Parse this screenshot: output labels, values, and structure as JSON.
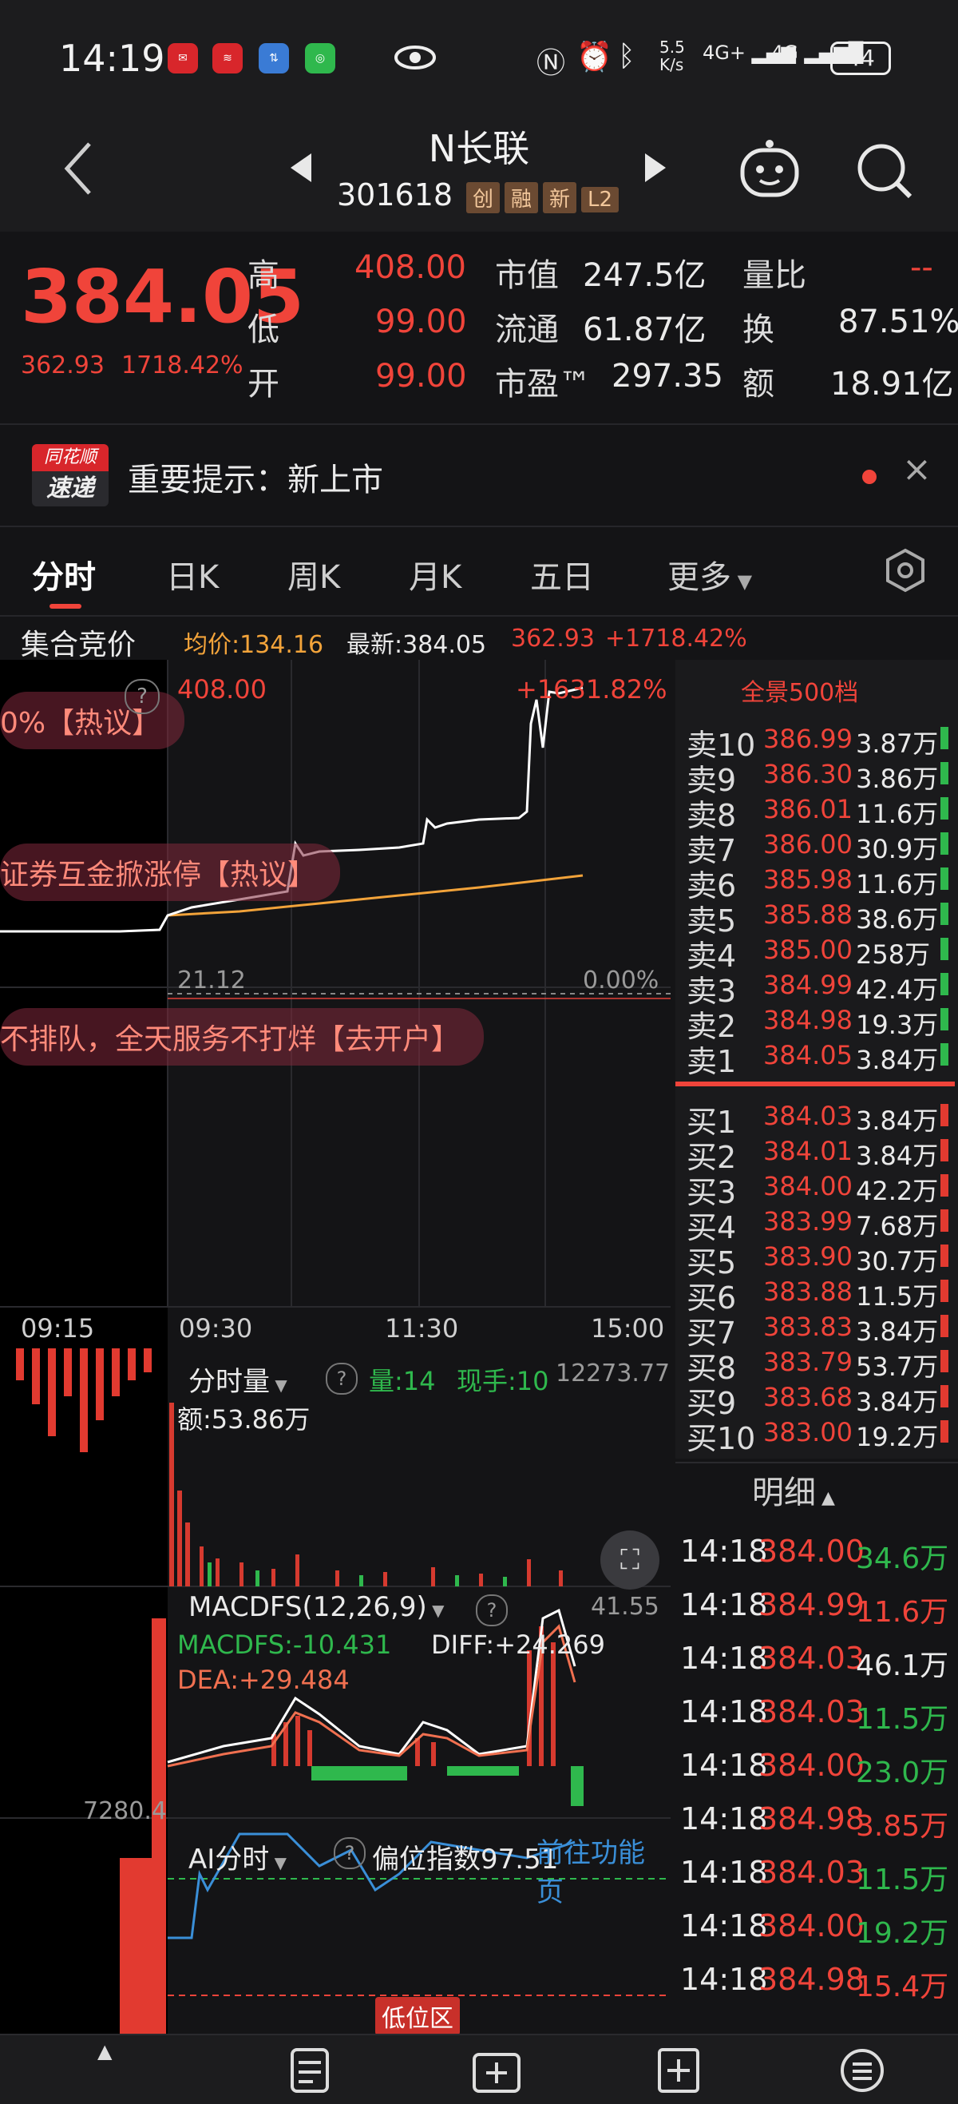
{
  "status_bar": {
    "time": "14:19",
    "net_speed_top": "5.5",
    "net_speed_bottom": "K/s",
    "signal1": "4G+",
    "signal2": "4G",
    "battery": "44"
  },
  "header": {
    "title": "N长联",
    "code": "301618",
    "tags": [
      "创",
      "融",
      "新",
      "L2"
    ]
  },
  "quote": {
    "price": "384.05",
    "change": "362.93",
    "change_pct": "1718.42%",
    "high_label": "高",
    "high": "408.00",
    "low_label": "低",
    "low": "99.00",
    "open_label": "开",
    "open": "99.00",
    "mcap_label": "市值",
    "mcap": "247.5亿",
    "float_label": "流通",
    "float": "61.87亿",
    "pe_label": "市盈™",
    "pe": "297.35",
    "vol_ratio_label": "量比",
    "vol_ratio": "--",
    "turnover_label": "换",
    "turnover": "87.51%",
    "amount_label": "额",
    "amount": "18.91亿"
  },
  "notice": {
    "logo_top": "同花顺",
    "logo_bottom": "速递",
    "text": "重要提示：新上市"
  },
  "tabs": [
    "分时",
    "日K",
    "周K",
    "月K",
    "五日",
    "更多"
  ],
  "info_line": {
    "label": "集合竞价",
    "avg": "均价:134.16",
    "latest": "最新:384.05",
    "chg": "362.93",
    "pct": "+1718.42%"
  },
  "chart": {
    "top_price": "408.00",
    "top_pct": "+1631.82%",
    "base_price": "21.12",
    "base_pct": "0.00%",
    "banner1": "0%【热议】",
    "banner2": "证券互金掀涨停【热议】",
    "banner3": "不排队，全天服务不打烊【去开户】",
    "times": [
      "09:15",
      "09:30",
      "11:30",
      "15:00"
    ],
    "vol_title": "分时量",
    "vol_qty": "量:14",
    "vol_hand": "现手:10",
    "vol_max": "12273.77",
    "vol_amount": "额:53.86万",
    "vol_side": "7280.4",
    "macd_title": "MACDFS(12,26,9)",
    "macd_val": "MACDFS:-10.431",
    "diff_val": "DIFF:+24.269",
    "dea_val": "DEA:+29.484",
    "macd_max": "41.55",
    "ai_title": "AI分时",
    "ai_index": "偏位指数97.51",
    "ai_func": "前往功能页",
    "ai_low": "低位区"
  },
  "orderbook": {
    "title": "全景500档",
    "sells": [
      {
        "k": "卖10",
        "p": "386.99",
        "v": "3.87万"
      },
      {
        "k": "卖9",
        "p": "386.30",
        "v": "3.86万"
      },
      {
        "k": "卖8",
        "p": "386.01",
        "v": "11.6万"
      },
      {
        "k": "卖7",
        "p": "386.00",
        "v": "30.9万"
      },
      {
        "k": "卖6",
        "p": "385.98",
        "v": "11.6万"
      },
      {
        "k": "卖5",
        "p": "385.88",
        "v": "38.6万"
      },
      {
        "k": "卖4",
        "p": "385.00",
        "v": "258万"
      },
      {
        "k": "卖3",
        "p": "384.99",
        "v": "42.4万"
      },
      {
        "k": "卖2",
        "p": "384.98",
        "v": "19.3万"
      },
      {
        "k": "卖1",
        "p": "384.05",
        "v": "3.84万"
      }
    ],
    "buys": [
      {
        "k": "买1",
        "p": "384.03",
        "v": "3.84万"
      },
      {
        "k": "买2",
        "p": "384.01",
        "v": "3.84万"
      },
      {
        "k": "买3",
        "p": "384.00",
        "v": "42.2万"
      },
      {
        "k": "买4",
        "p": "383.99",
        "v": "7.68万"
      },
      {
        "k": "买5",
        "p": "383.90",
        "v": "30.7万"
      },
      {
        "k": "买6",
        "p": "383.88",
        "v": "11.5万"
      },
      {
        "k": "买7",
        "p": "383.83",
        "v": "3.84万"
      },
      {
        "k": "买8",
        "p": "383.79",
        "v": "53.7万"
      },
      {
        "k": "买9",
        "p": "383.68",
        "v": "3.84万"
      },
      {
        "k": "买10",
        "p": "383.00",
        "v": "19.2万"
      }
    ]
  },
  "ticks": {
    "title": "明细",
    "rows": [
      {
        "t": "14:18",
        "p": "384.00",
        "v": "34.6万",
        "dir": "green"
      },
      {
        "t": "14:18",
        "p": "384.99",
        "v": "11.6万",
        "dir": "red"
      },
      {
        "t": "14:18",
        "p": "384.03",
        "v": "46.1万",
        "dir": "white"
      },
      {
        "t": "14:18",
        "p": "384.03",
        "v": "11.5万",
        "dir": "green"
      },
      {
        "t": "14:18",
        "p": "384.00",
        "v": "23.0万",
        "dir": "green"
      },
      {
        "t": "14:18",
        "p": "384.98",
        "v": "3.85万",
        "dir": "red"
      },
      {
        "t": "14:18",
        "p": "384.03",
        "v": "11.5万",
        "dir": "green"
      },
      {
        "t": "14:18",
        "p": "384.00",
        "v": "19.2万",
        "dir": "green"
      },
      {
        "t": "14:18",
        "p": "384.98",
        "v": "15.4万",
        "dir": "red"
      }
    ]
  },
  "colors": {
    "up": "#f0443a",
    "down": "#2fb84d",
    "avg": "#f2a33a",
    "line": "#ffffff"
  }
}
